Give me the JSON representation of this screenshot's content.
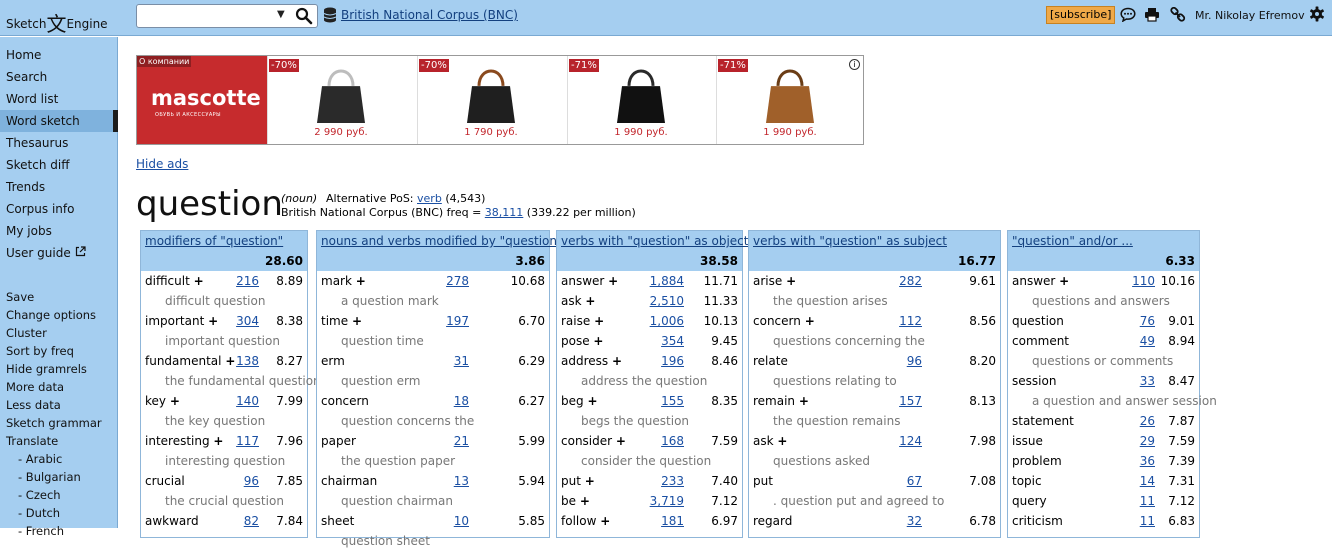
{
  "topbar": {
    "logo_left": "Sketch",
    "logo_glyph": "文",
    "logo_right": "Engine",
    "search_value": "",
    "search_placeholder": "",
    "corpus": "British National Corpus (BNC)",
    "subscribe": "[subscribe]",
    "user": "Mr. Nikolay Efremov",
    "icons": [
      "search-icon",
      "database-icon",
      "chat-icon",
      "print-icon",
      "link-icon",
      "gear-icon"
    ]
  },
  "sidebar": {
    "nav": [
      "Home",
      "Search",
      "Word list",
      "Word sketch",
      "Thesaurus",
      "Sketch diff",
      "Trends",
      "Corpus info",
      "My jobs",
      "User guide"
    ],
    "active": "Word sketch",
    "actions": [
      "Save",
      "Change options",
      "Cluster",
      "Sort by freq",
      "Hide gramrels",
      "More data",
      "Less data",
      "Sketch grammar",
      "Translate"
    ],
    "languages": [
      "- Arabic",
      "- Bulgarian",
      "- Czech",
      "- Dutch",
      "- French"
    ]
  },
  "ads": {
    "about": "О компании",
    "brand": "mascotte",
    "brand_sub": "ОБУВЬ И АКСЕССУАРЫ",
    "products": [
      {
        "discount": "-70%",
        "price": "2 990 руб.",
        "color": "#2a2a2a",
        "handle": "#bdbdbd"
      },
      {
        "discount": "-70%",
        "price": "1 790 руб.",
        "color": "#1f1f1f",
        "handle": "#8a4a1e"
      },
      {
        "discount": "-71%",
        "price": "1 990 руб.",
        "color": "#111111",
        "handle": "#2a2a2a"
      },
      {
        "discount": "-71%",
        "price": "1 990 руб.",
        "color": "#a0602a",
        "handle": "#6b3d16"
      }
    ],
    "hide_label": "Hide ads"
  },
  "headword": {
    "word": "question",
    "pos": "(noun)",
    "alt_label": "Alternative PoS:",
    "alt_pos": "verb",
    "alt_count": "(4,543)",
    "freq_label": "British National Corpus (BNC) freq =",
    "freq": "38,111",
    "per_million": "(339.22 per million)"
  },
  "gramrels": [
    {
      "title": "modifiers of \"question\"",
      "score": "28.60",
      "rows": [
        {
          "word": "difficult",
          "plus": true,
          "freq": "216",
          "score": "8.89",
          "example": "difficult question"
        },
        {
          "word": "important",
          "plus": true,
          "freq": "304",
          "score": "8.38",
          "example": "important question"
        },
        {
          "word": "fundamental",
          "plus": true,
          "freq": "138",
          "score": "8.27",
          "example": "the fundamental question"
        },
        {
          "word": "key",
          "plus": true,
          "freq": "140",
          "score": "7.99",
          "example": "the key question"
        },
        {
          "word": "interesting",
          "plus": true,
          "freq": "117",
          "score": "7.96",
          "example": "interesting question"
        },
        {
          "word": "crucial",
          "plus": false,
          "freq": "96",
          "score": "7.85",
          "example": "the crucial question"
        },
        {
          "word": "awkward",
          "plus": false,
          "freq": "82",
          "score": "7.84",
          "example": ""
        }
      ]
    },
    {
      "title": "nouns and verbs modified by \"question\"",
      "score": "3.86",
      "rows": [
        {
          "word": "mark",
          "plus": true,
          "freq": "278",
          "score": "10.68",
          "example": "a question mark"
        },
        {
          "word": "time",
          "plus": true,
          "freq": "197",
          "score": "6.70",
          "example": "question time"
        },
        {
          "word": "erm",
          "plus": false,
          "freq": "31",
          "score": "6.29",
          "example": "question erm"
        },
        {
          "word": "concern",
          "plus": false,
          "freq": "18",
          "score": "6.27",
          "example": "question concerns the"
        },
        {
          "word": "paper",
          "plus": false,
          "freq": "21",
          "score": "5.99",
          "example": "the question paper"
        },
        {
          "word": "chairman",
          "plus": false,
          "freq": "13",
          "score": "5.94",
          "example": "question chairman"
        },
        {
          "word": "sheet",
          "plus": false,
          "freq": "10",
          "score": "5.85",
          "example": "question sheet"
        }
      ]
    },
    {
      "title": "verbs with \"question\" as object",
      "score": "38.58",
      "rows": [
        {
          "word": "answer",
          "plus": true,
          "freq": "1,884",
          "score": "11.71",
          "example": ""
        },
        {
          "word": "ask",
          "plus": true,
          "freq": "2,510",
          "score": "11.33",
          "example": ""
        },
        {
          "word": "raise",
          "plus": true,
          "freq": "1,006",
          "score": "10.13",
          "example": ""
        },
        {
          "word": "pose",
          "plus": true,
          "freq": "354",
          "score": "9.45",
          "example": ""
        },
        {
          "word": "address",
          "plus": true,
          "freq": "196",
          "score": "8.46",
          "example": "address the question"
        },
        {
          "word": "beg",
          "plus": true,
          "freq": "155",
          "score": "8.35",
          "example": "begs the question"
        },
        {
          "word": "consider",
          "plus": true,
          "freq": "168",
          "score": "7.59",
          "example": "consider the question"
        },
        {
          "word": "put",
          "plus": true,
          "freq": "233",
          "score": "7.40",
          "example": ""
        },
        {
          "word": "be",
          "plus": true,
          "freq": "3,719",
          "score": "7.12",
          "example": ""
        },
        {
          "word": "follow",
          "plus": true,
          "freq": "181",
          "score": "6.97",
          "example": ""
        }
      ]
    },
    {
      "title": "verbs with \"question\" as subject",
      "score": "16.77",
      "rows": [
        {
          "word": "arise",
          "plus": true,
          "freq": "282",
          "score": "9.61",
          "example": "the question arises"
        },
        {
          "word": "concern",
          "plus": true,
          "freq": "112",
          "score": "8.56",
          "example": "questions concerning the"
        },
        {
          "word": "relate",
          "plus": false,
          "freq": "96",
          "score": "8.20",
          "example": "questions relating to"
        },
        {
          "word": "remain",
          "plus": true,
          "freq": "157",
          "score": "8.13",
          "example": "the question remains"
        },
        {
          "word": "ask",
          "plus": true,
          "freq": "124",
          "score": "7.98",
          "example": "questions asked"
        },
        {
          "word": "put",
          "plus": false,
          "freq": "67",
          "score": "7.08",
          "example": ". question put and agreed to"
        },
        {
          "word": "regard",
          "plus": false,
          "freq": "32",
          "score": "6.78",
          "example": ""
        }
      ]
    },
    {
      "title": "\"question\" and/or ...",
      "score": "6.33",
      "rows": [
        {
          "word": "answer",
          "plus": true,
          "freq": "110",
          "score": "10.16",
          "example": "questions and answers"
        },
        {
          "word": "question",
          "plus": false,
          "freq": "76",
          "score": "9.01",
          "example": ""
        },
        {
          "word": "comment",
          "plus": false,
          "freq": "49",
          "score": "8.94",
          "example": "questions or comments"
        },
        {
          "word": "session",
          "plus": false,
          "freq": "33",
          "score": "8.47",
          "example": "a question and answer session"
        },
        {
          "word": "statement",
          "plus": false,
          "freq": "26",
          "score": "7.87",
          "example": ""
        },
        {
          "word": "issue",
          "plus": false,
          "freq": "29",
          "score": "7.59",
          "example": ""
        },
        {
          "word": "problem",
          "plus": false,
          "freq": "36",
          "score": "7.39",
          "example": ""
        },
        {
          "word": "topic",
          "plus": false,
          "freq": "14",
          "score": "7.31",
          "example": ""
        },
        {
          "word": "query",
          "plus": false,
          "freq": "11",
          "score": "7.12",
          "example": ""
        },
        {
          "word": "criticism",
          "plus": false,
          "freq": "11",
          "score": "6.83",
          "example": ""
        }
      ]
    }
  ],
  "colors": {
    "panel_bg": "#a5cef0",
    "active_nav": "#7fb2dd",
    "link": "#1a4fa3",
    "subscribe_bg": "#f0a948",
    "ad_brand_bg": "#c62b2d",
    "price": "#c2272d"
  }
}
